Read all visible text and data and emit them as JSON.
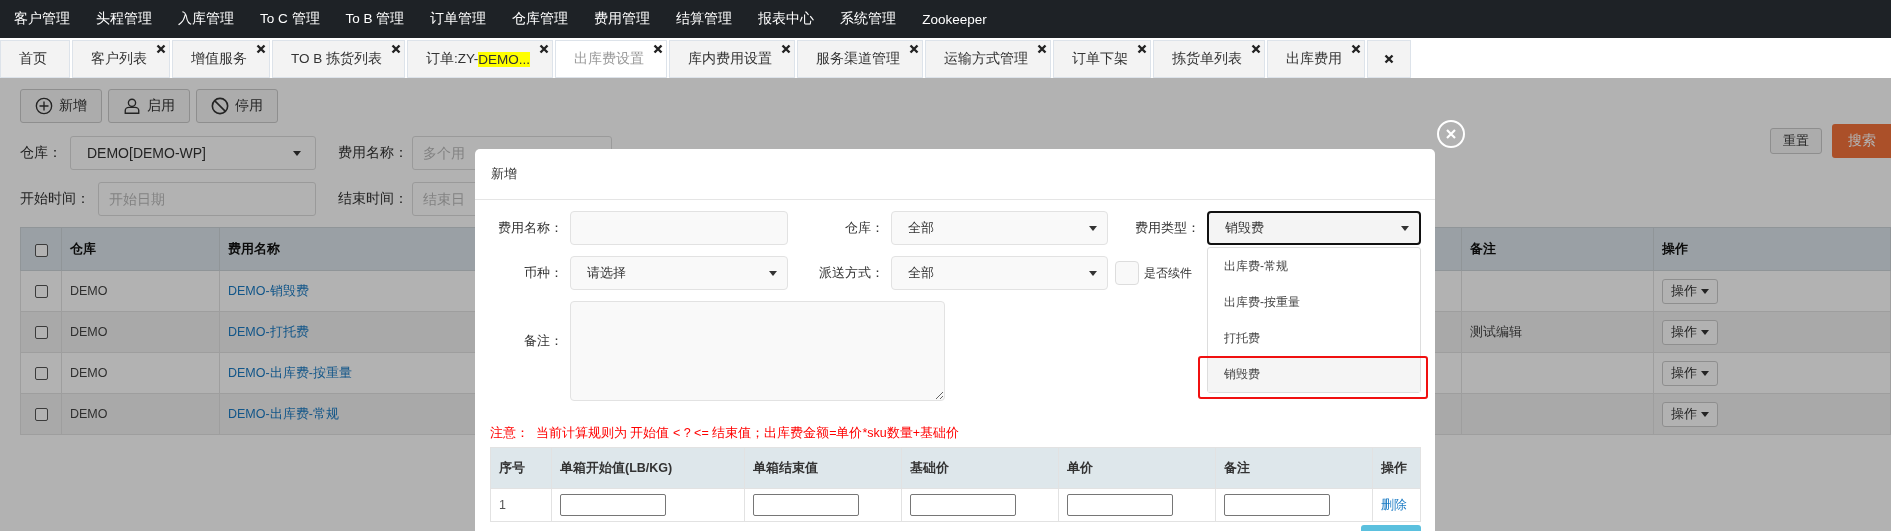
{
  "top_menu": [
    "客户管理",
    "头程管理",
    "入库管理",
    "To C 管理",
    "To B 管理",
    "订单管理",
    "仓库管理",
    "费用管理",
    "结算管理",
    "报表中心",
    "系统管理",
    "Zookeeper"
  ],
  "tabs": [
    {
      "label": "首页",
      "closable": false,
      "selected": false
    },
    {
      "label": "客户列表",
      "closable": true,
      "selected": false
    },
    {
      "label": "增值服务",
      "closable": true,
      "selected": false
    },
    {
      "label": "TO B 拣货列表",
      "closable": true,
      "selected": false
    },
    {
      "label": "订单:ZY-",
      "highlight": "DEMO...",
      "closable": true,
      "selected": false
    },
    {
      "label": "出库费设置",
      "closable": true,
      "selected": true
    },
    {
      "label": "库内费用设置",
      "closable": true,
      "selected": false
    },
    {
      "label": "服务渠道管理",
      "closable": true,
      "selected": false
    },
    {
      "label": "运输方式管理",
      "closable": true,
      "selected": false
    },
    {
      "label": "订单下架",
      "closable": true,
      "selected": false
    },
    {
      "label": "拣货单列表",
      "closable": true,
      "selected": false
    },
    {
      "label": "出库费用",
      "closable": true,
      "selected": false
    },
    {
      "closable": true,
      "selected": false
    }
  ],
  "toolbar": [
    {
      "label": "新增"
    },
    {
      "label": "启用"
    },
    {
      "label": "停用"
    }
  ],
  "filters": {
    "warehouse_label": "仓库：",
    "warehouse_value": "DEMO[DEMO-WP]",
    "fee_name_label": "费用名称：",
    "fee_name_placeholder": "多个用",
    "start_label": "开始时间：",
    "start_placeholder": "开始日期",
    "end_label": "结束时间：",
    "end_placeholder": "结束日",
    "reset": "重置",
    "search": "搜索"
  },
  "table": {
    "all_checked": false,
    "columns": [
      "仓库",
      "费用名称",
      "备注",
      "操作"
    ],
    "rows": [
      {
        "checked": false,
        "warehouse": "DEMO",
        "fee_name": "DEMO-销毁费",
        "action": "操作"
      },
      {
        "checked": false,
        "warehouse": "DEMO",
        "fee_name": "DEMO-打托费",
        "note": "测试编辑",
        "action": "操作"
      },
      {
        "checked": false,
        "warehouse": "DEMO",
        "fee_name": "DEMO-出库费-按重量",
        "action": "操作"
      },
      {
        "checked": false,
        "warehouse": "DEMO",
        "fee_name": "DEMO-出库费-常规",
        "action": "操作"
      }
    ]
  },
  "modal": {
    "title": "新增",
    "fields": [
      {
        "kind": "text",
        "label": "费用名称："
      },
      {
        "kind": "select",
        "label": "仓库：",
        "value": "全部",
        "focused": false
      },
      {
        "kind": "select",
        "label": "费用类型：",
        "value": "销毁费",
        "focused": true
      },
      {
        "kind": "select",
        "label": "币种：",
        "value": "请选择",
        "focused": false
      },
      {
        "kind": "select",
        "label": "派送方式：",
        "value": "全部",
        "focused": false
      },
      {
        "kind": "checkbox",
        "label": "是否续件",
        "checked": false
      }
    ],
    "dropdown": [
      {
        "label": "出库费-常规",
        "selected": false
      },
      {
        "label": "出库费-按重量",
        "selected": false
      },
      {
        "label": "打托费",
        "selected": false
      },
      {
        "label": "销毁费",
        "selected": true
      }
    ],
    "remark_label": "备注：",
    "rule": "注意：  当前计算规则为 开始值 < ? <= 结束值；出库费金额=单价*sku数量+基础价",
    "grid": {
      "columns": [
        "序号",
        "单箱开始值(LB/KG)",
        "单箱结束值",
        "基础价",
        "单价",
        "备注",
        "操作"
      ],
      "rows": [
        {
          "index": "1",
          "action": "删除"
        }
      ]
    }
  }
}
